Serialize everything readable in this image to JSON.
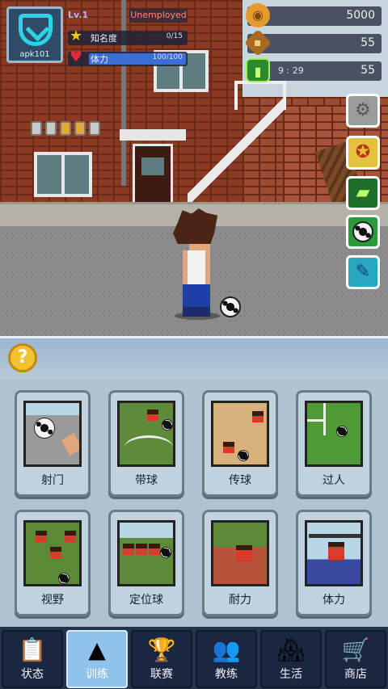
{
  "profile": {
    "tag": "apk101",
    "level": "Lv.1",
    "job": "Unemployed",
    "fame_label": "知名度",
    "fame_value": "0/15",
    "fame_fill": 0,
    "stamina_label": "体力",
    "stamina_value": "100/100",
    "stamina_fill": 1.0
  },
  "resources": {
    "coins": "5000",
    "gems": "55",
    "energy_timer": "9 : 29",
    "energy": "55"
  },
  "side_buttons": [
    "settings-icon",
    "medal-icon",
    "ticket-icon",
    "soccer-ball-icon",
    "boot-icon"
  ],
  "panel": {
    "help": "?",
    "cards": [
      {
        "label": "射门"
      },
      {
        "label": "带球"
      },
      {
        "label": "传球"
      },
      {
        "label": "过人"
      },
      {
        "label": "视野"
      },
      {
        "label": "定位球"
      },
      {
        "label": "耐力"
      },
      {
        "label": "体力"
      }
    ]
  },
  "nav": {
    "tabs": [
      {
        "label": "状态",
        "icon": "clipboard-icon"
      },
      {
        "label": "训练",
        "icon": "cones-icon"
      },
      {
        "label": "联赛",
        "icon": "trophy-icon"
      },
      {
        "label": "教练",
        "icon": "coaches-icon"
      },
      {
        "label": "生活",
        "icon": "city-icon"
      },
      {
        "label": "商店",
        "icon": "cart-icon"
      }
    ],
    "active": 1
  },
  "colors": {
    "accent": "#8fc2ea",
    "nav_bg": "#24324a",
    "panel_bg": "#b0c2d1",
    "stamina_fill": "#3a6fd8",
    "coin": "#e49a2c"
  }
}
